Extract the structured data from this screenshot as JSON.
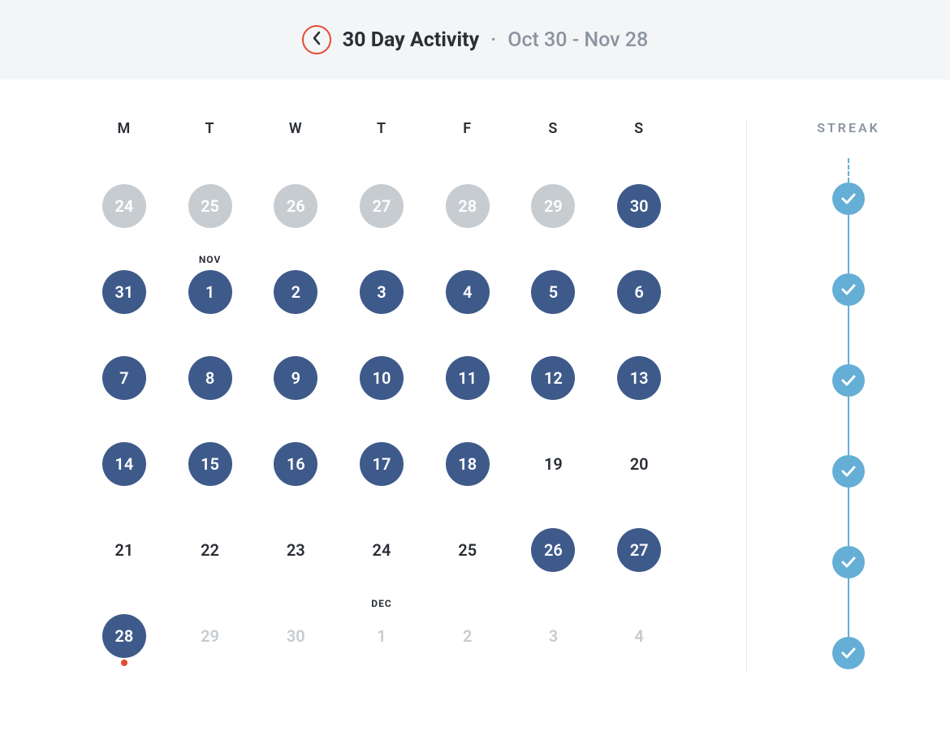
{
  "header": {
    "title": "30 Day Activity",
    "separator": "·",
    "range": "Oct 30 - Nov 28"
  },
  "weekdays": [
    "M",
    "T",
    "W",
    "T",
    "F",
    "S",
    "S"
  ],
  "calendar": {
    "rows": [
      [
        {
          "day": "24",
          "style": "inactive-past",
          "monthLabel": ""
        },
        {
          "day": "25",
          "style": "inactive-past",
          "monthLabel": ""
        },
        {
          "day": "26",
          "style": "inactive-past",
          "monthLabel": ""
        },
        {
          "day": "27",
          "style": "inactive-past",
          "monthLabel": ""
        },
        {
          "day": "28",
          "style": "inactive-past",
          "monthLabel": ""
        },
        {
          "day": "29",
          "style": "inactive-past",
          "monthLabel": ""
        },
        {
          "day": "30",
          "style": "active",
          "monthLabel": ""
        }
      ],
      [
        {
          "day": "31",
          "style": "active",
          "monthLabel": ""
        },
        {
          "day": "1",
          "style": "active",
          "monthLabel": "NOV"
        },
        {
          "day": "2",
          "style": "active",
          "monthLabel": ""
        },
        {
          "day": "3",
          "style": "active",
          "monthLabel": ""
        },
        {
          "day": "4",
          "style": "active",
          "monthLabel": ""
        },
        {
          "day": "5",
          "style": "active",
          "monthLabel": ""
        },
        {
          "day": "6",
          "style": "active",
          "monthLabel": ""
        }
      ],
      [
        {
          "day": "7",
          "style": "active",
          "monthLabel": ""
        },
        {
          "day": "8",
          "style": "active",
          "monthLabel": ""
        },
        {
          "day": "9",
          "style": "active",
          "monthLabel": ""
        },
        {
          "day": "10",
          "style": "active",
          "monthLabel": ""
        },
        {
          "day": "11",
          "style": "active",
          "monthLabel": ""
        },
        {
          "day": "12",
          "style": "active",
          "monthLabel": ""
        },
        {
          "day": "13",
          "style": "active",
          "monthLabel": ""
        }
      ],
      [
        {
          "day": "14",
          "style": "active",
          "monthLabel": ""
        },
        {
          "day": "15",
          "style": "active",
          "monthLabel": ""
        },
        {
          "day": "16",
          "style": "active",
          "monthLabel": ""
        },
        {
          "day": "17",
          "style": "active",
          "monthLabel": ""
        },
        {
          "day": "18",
          "style": "active",
          "monthLabel": ""
        },
        {
          "day": "19",
          "style": "plain",
          "monthLabel": ""
        },
        {
          "day": "20",
          "style": "plain",
          "monthLabel": ""
        }
      ],
      [
        {
          "day": "21",
          "style": "plain",
          "monthLabel": ""
        },
        {
          "day": "22",
          "style": "plain",
          "monthLabel": ""
        },
        {
          "day": "23",
          "style": "plain",
          "monthLabel": ""
        },
        {
          "day": "24",
          "style": "plain",
          "monthLabel": ""
        },
        {
          "day": "25",
          "style": "plain",
          "monthLabel": ""
        },
        {
          "day": "26",
          "style": "active",
          "monthLabel": ""
        },
        {
          "day": "27",
          "style": "active",
          "monthLabel": ""
        }
      ],
      [
        {
          "day": "28",
          "style": "active",
          "monthLabel": "",
          "today": true
        },
        {
          "day": "29",
          "style": "inactive-future",
          "monthLabel": ""
        },
        {
          "day": "30",
          "style": "inactive-future",
          "monthLabel": ""
        },
        {
          "day": "1",
          "style": "inactive-future",
          "monthLabel": "DEC"
        },
        {
          "day": "2",
          "style": "inactive-future",
          "monthLabel": ""
        },
        {
          "day": "3",
          "style": "inactive-future",
          "monthLabel": ""
        },
        {
          "day": "4",
          "style": "inactive-future",
          "monthLabel": ""
        }
      ]
    ]
  },
  "streak": {
    "label": "STREAK",
    "count": 6
  }
}
